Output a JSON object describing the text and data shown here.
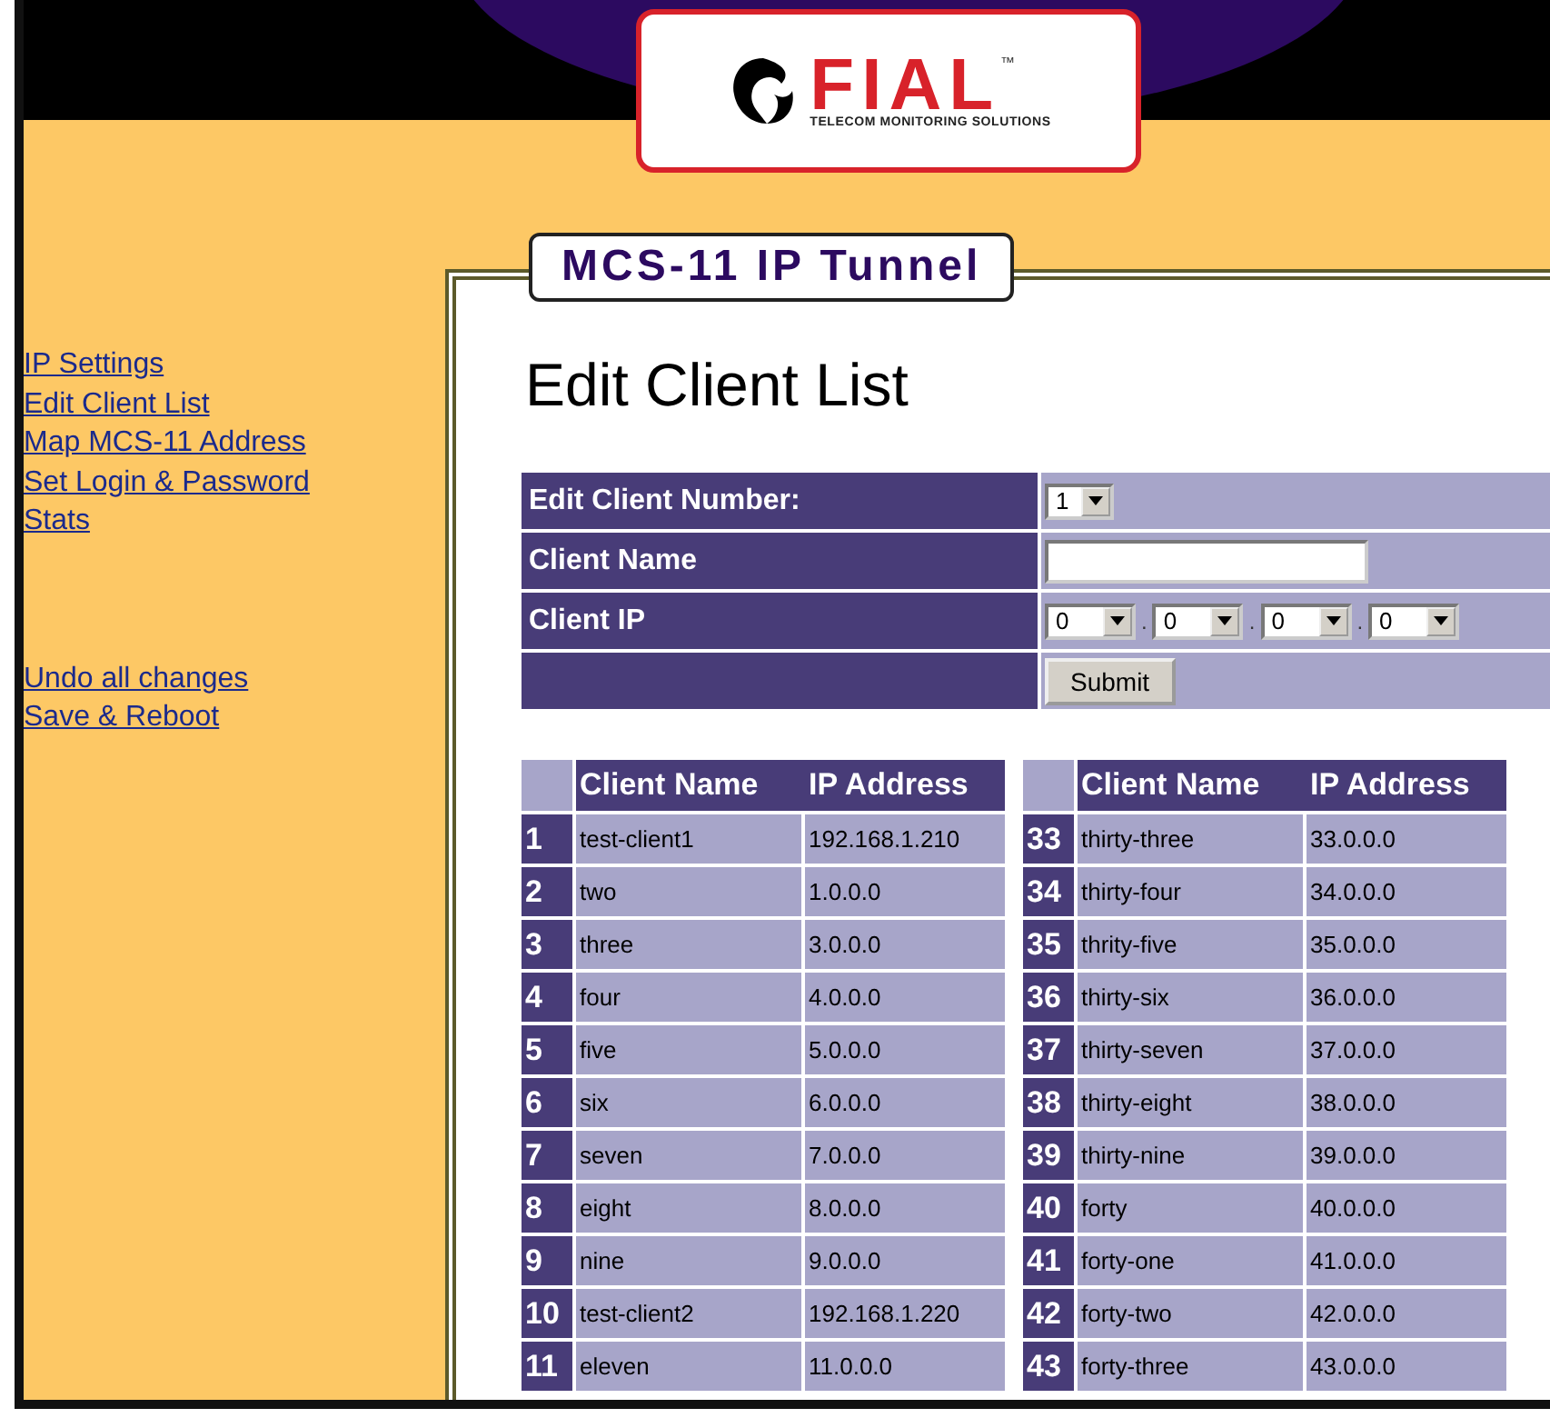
{
  "logo": {
    "brand": "FIAL",
    "trademark": "™",
    "tagline": "TELECOM MONITORING SOLUTIONS"
  },
  "banner_title": "MCS-11 IP Tunnel",
  "sidebar": {
    "links": [
      "IP Settings",
      "Edit Client List",
      "Map MCS-11 Address",
      "Set Login & Password",
      "Stats"
    ],
    "actions": [
      "Undo all changes",
      "Save & Reboot"
    ]
  },
  "page_title": "Edit Client List",
  "form": {
    "rows": [
      {
        "kind": "select",
        "label": "Edit Client Number:",
        "value": "1"
      },
      {
        "kind": "text",
        "label": "Client Name"
      },
      {
        "kind": "ip",
        "label": "Client IP",
        "octets": [
          "0",
          "0",
          "0",
          "0"
        ],
        "separators": [
          ".",
          ".",
          "."
        ]
      },
      {
        "kind": "button",
        "button": "Submit"
      }
    ]
  },
  "client_tables": [
    {
      "columns": [
        "Client Name",
        "IP Address"
      ],
      "rows": [
        {
          "number": "1",
          "name": "test-client1",
          "ip": "192.168.1.210"
        },
        {
          "number": "2",
          "name": "two",
          "ip": "1.0.0.0"
        },
        {
          "number": "3",
          "name": "three",
          "ip": "3.0.0.0"
        },
        {
          "number": "4",
          "name": "four",
          "ip": "4.0.0.0"
        },
        {
          "number": "5",
          "name": "five",
          "ip": "5.0.0.0"
        },
        {
          "number": "6",
          "name": "six",
          "ip": "6.0.0.0"
        },
        {
          "number": "7",
          "name": "seven",
          "ip": "7.0.0.0"
        },
        {
          "number": "8",
          "name": "eight",
          "ip": "8.0.0.0"
        },
        {
          "number": "9",
          "name": "nine",
          "ip": "9.0.0.0"
        },
        {
          "number": "10",
          "name": "test-client2",
          "ip": "192.168.1.220"
        },
        {
          "number": "11",
          "name": "eleven",
          "ip": "11.0.0.0"
        }
      ]
    },
    {
      "columns": [
        "Client Name",
        "IP Address"
      ],
      "rows": [
        {
          "number": "33",
          "name": "thirty-three",
          "ip": "33.0.0.0"
        },
        {
          "number": "34",
          "name": "thirty-four",
          "ip": "34.0.0.0"
        },
        {
          "number": "35",
          "name": "thrity-five",
          "ip": "35.0.0.0"
        },
        {
          "number": "36",
          "name": "thirty-six",
          "ip": "36.0.0.0"
        },
        {
          "number": "37",
          "name": "thirty-seven",
          "ip": "37.0.0.0"
        },
        {
          "number": "38",
          "name": "thirty-eight",
          "ip": "38.0.0.0"
        },
        {
          "number": "39",
          "name": "thirty-nine",
          "ip": "39.0.0.0"
        },
        {
          "number": "40",
          "name": "forty",
          "ip": "40.0.0.0"
        },
        {
          "number": "41",
          "name": "forty-one",
          "ip": "41.0.0.0"
        },
        {
          "number": "42",
          "name": "forty-two",
          "ip": "42.0.0.0"
        },
        {
          "number": "43",
          "name": "forty-three",
          "ip": "43.0.0.0"
        }
      ]
    }
  ]
}
